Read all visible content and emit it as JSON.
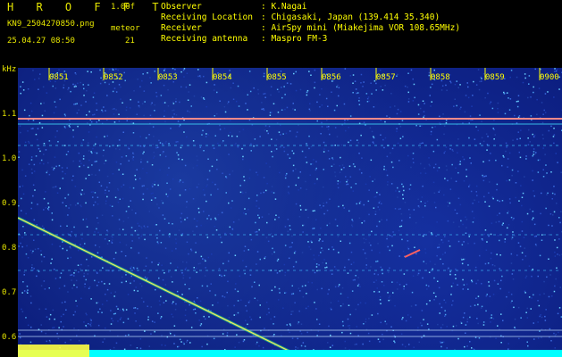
{
  "header": {
    "logo": "H R O F F T",
    "version": "1.00f",
    "filename": "KN9_2504270850.png",
    "meteor_label": "meteor",
    "datetime": "25.04.27 08:50",
    "count": "21",
    "info": [
      {
        "key": "Observer",
        "value": ": K.Nagai"
      },
      {
        "key": "Receiving Location",
        "value": ": Chigasaki, Japan (139.414 35.340)"
      },
      {
        "key": "Receiver",
        "value": ": AirSpy mini (Miakejima VOR 108.65MHz)"
      },
      {
        "key": "Receiving antenna",
        "value": ": Maspro FM-3"
      }
    ]
  },
  "axes": {
    "y_unit": "kHz",
    "y_ticks": [
      "1.1",
      "1.0",
      "0.9",
      "0.8",
      "0.7",
      "0.6"
    ],
    "x_ticks": [
      "0851",
      "0852",
      "0853",
      "0854",
      "0855",
      "0856",
      "0857",
      "0858",
      "0859",
      "0900"
    ]
  },
  "colors": {
    "background": "#0a1a78",
    "text": "#ffff00",
    "signal_line": "#ff8080",
    "meteor_trace": "#ffe060",
    "floor": "#00ffff"
  }
}
